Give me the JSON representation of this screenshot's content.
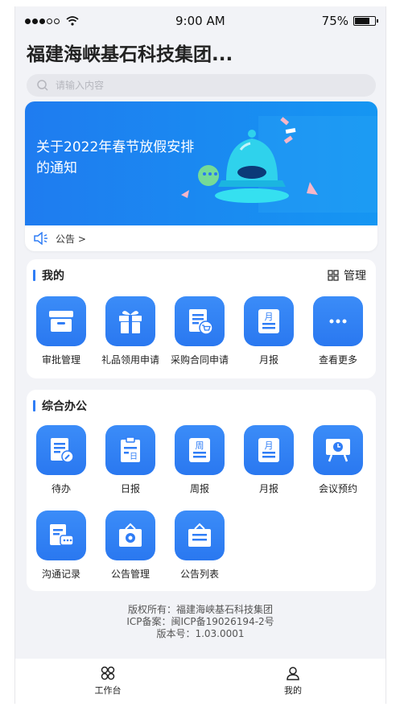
{
  "status": {
    "time": "9:00 AM",
    "battery": "75%",
    "battery_level": 0.75
  },
  "header": {
    "title": "福建海峡基石科技集团..."
  },
  "search": {
    "placeholder": "请输入内容"
  },
  "banner": {
    "title": "关于2022年春节放假安排的通知",
    "link_label": "公告 >"
  },
  "mine": {
    "title": "我的",
    "manage_label": "管理",
    "items": [
      {
        "label": "审批管理",
        "icon": "archive-box-icon"
      },
      {
        "label": "礼品领用申请",
        "icon": "gift-icon"
      },
      {
        "label": "采购合同申请",
        "icon": "contract-cart-icon"
      },
      {
        "label": "月报",
        "icon": "monthly-report-icon"
      },
      {
        "label": "查看更多",
        "icon": "more-dots-icon"
      }
    ]
  },
  "office": {
    "title": "综合办公",
    "items": [
      {
        "label": "待办",
        "icon": "todo-icon"
      },
      {
        "label": "日报",
        "icon": "daily-report-icon"
      },
      {
        "label": "周报",
        "icon": "weekly-report-icon"
      },
      {
        "label": "月报",
        "icon": "monthly-report-icon"
      },
      {
        "label": "会议预约",
        "icon": "meeting-icon"
      },
      {
        "label": "沟通记录",
        "icon": "chat-record-icon"
      },
      {
        "label": "公告管理",
        "icon": "notice-manage-icon"
      },
      {
        "label": "公告列表",
        "icon": "notice-list-icon"
      }
    ],
    "glyphs": {
      "daily": "日",
      "weekly": "周",
      "monthly": "月"
    }
  },
  "footer": {
    "copyright": "版权所有：福建海峡基石科技集团",
    "icp": "ICP备案：闽ICP备19026194-2号",
    "version": "版本号：1.03.0001"
  },
  "tabbar": {
    "workbench": "工作台",
    "mine": "我的"
  },
  "colors": {
    "accent": "#2f7df6",
    "banner": "#1f7cf0"
  }
}
